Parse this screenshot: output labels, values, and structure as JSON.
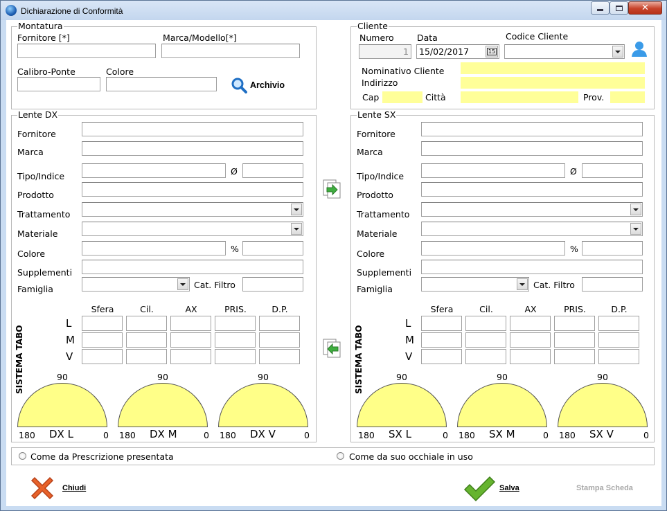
{
  "window": {
    "title": "Dichiarazione di Conformità"
  },
  "montatura": {
    "legend": "Montatura",
    "fornitore_label": "Fornitore [*]",
    "marca_label": "Marca/Modello[*]",
    "calibro_label": "Calibro-Ponte",
    "colore_label": "Colore",
    "archivio_label": "Archivio",
    "fornitore_value": "",
    "marca_value": "",
    "calibro_value": "",
    "colore_value": ""
  },
  "cliente": {
    "legend": "Cliente",
    "numero_label": "Numero",
    "numero_value": "1",
    "data_label": "Data",
    "data_value": "15/02/2017",
    "codice_label": "Codice Cliente",
    "codice_value": "",
    "nominativo_label": "Nominativo Cliente",
    "indirizzo_label": "Indirizzo",
    "cap_label": "Cap",
    "citta_label": "Città",
    "prov_label": "Prov.",
    "nominativo_value": "",
    "indirizzo_value": "",
    "cap_value": "",
    "citta_value": "",
    "prov_value": ""
  },
  "lente_dx": {
    "legend": "Lente DX",
    "fornitore": "Fornitore",
    "marca": "Marca",
    "tipo": "Tipo/Indice",
    "diam": "Ø",
    "prodotto": "Prodotto",
    "trattamento": "Trattamento",
    "materiale": "Materiale",
    "colore": "Colore",
    "perc": "%",
    "supplementi": "Supplementi",
    "famiglia": "Famiglia",
    "filtro": "Cat. Filtro",
    "cols": [
      "Sfera",
      "Cil.",
      "AX",
      "PRIS.",
      "D.P."
    ],
    "rows": [
      "L",
      "M",
      "V"
    ],
    "tabo": "SISTEMA TABO",
    "g90": "90",
    "g180": "180",
    "g0": "0",
    "gauges": [
      "DX L",
      "DX M",
      "DX V"
    ]
  },
  "lente_sx": {
    "legend": "Lente SX",
    "fornitore": "Fornitore",
    "marca": "Marca",
    "tipo": "Tipo/Indice",
    "diam": "Ø",
    "prodotto": "Prodotto",
    "trattamento": "Trattamento",
    "materiale": "Materiale",
    "colore": "Colore",
    "perc": "%",
    "supplementi": "Supplementi",
    "famiglia": "Famiglia",
    "filtro": "Cat. Filtro",
    "cols": [
      "Sfera",
      "Cil.",
      "AX",
      "PRIS.",
      "D.P."
    ],
    "rows": [
      "L",
      "M",
      "V"
    ],
    "tabo": "SISTEMA TABO",
    "g90": "90",
    "g180": "180",
    "g0": "0",
    "gauges": [
      "SX L",
      "SX M",
      "SX V"
    ]
  },
  "options": {
    "prescrizione": "Come da Prescrizione presentata",
    "occhiale": "Come da suo occhiale in uso"
  },
  "footer": {
    "chiudi": "Chiudi",
    "salva": "Salva",
    "stampa": "Stampa Scheda"
  },
  "colors": {
    "yellow_field": "#ffff99",
    "gauge_fill": "#ffff88",
    "title_bg": "#c9dcf2",
    "close_red": "#c7432a"
  }
}
